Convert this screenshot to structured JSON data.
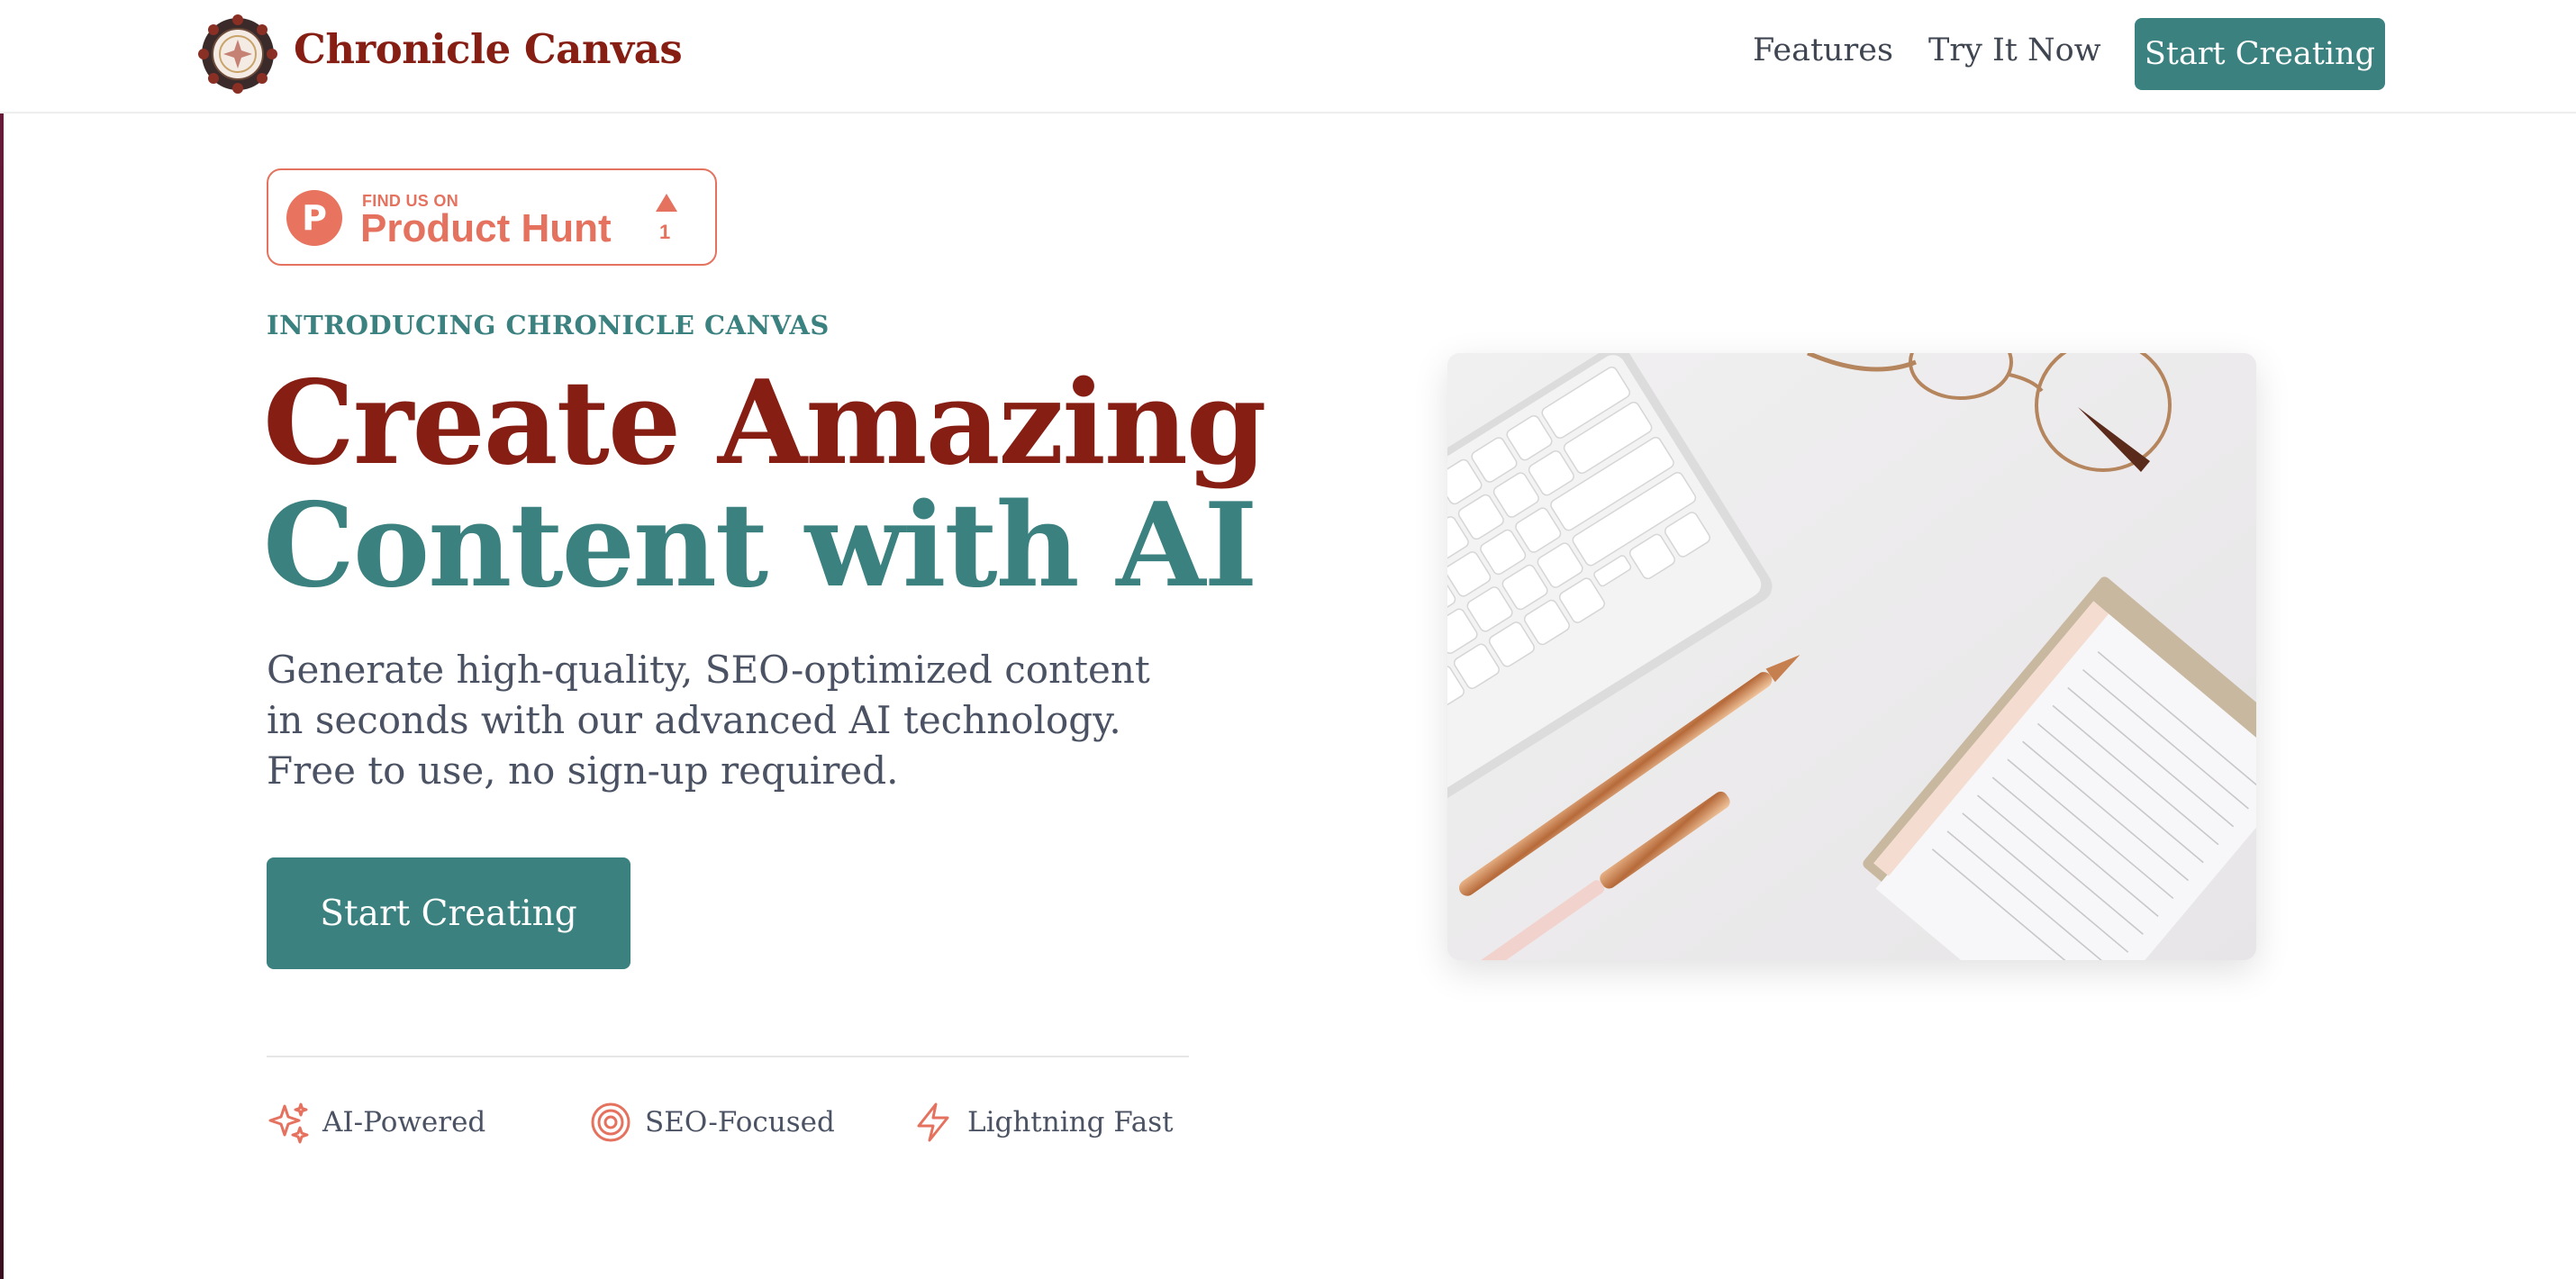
{
  "header": {
    "brand": "Chronicle Canvas",
    "logo_icon": "ornamental-seal",
    "nav": [
      {
        "label": "Features"
      },
      {
        "label": "Try It Now"
      }
    ],
    "cta_label": "Start Creating"
  },
  "product_hunt": {
    "small_text": "FIND US ON",
    "name": "Product Hunt",
    "logo_letter": "P",
    "votes": "1"
  },
  "hero": {
    "eyebrow": "INTRODUCING CHRONICLE CANVAS",
    "title_line1": "Create Amazing",
    "title_line2": "Content with AI",
    "subtitle": "Generate high-quality, SEO-optimized content in seconds with our advanced AI technology. Free to use, no sign-up required.",
    "cta_label": "Start Creating",
    "image_icon": "desk-workspace-photo"
  },
  "features": [
    {
      "label": "AI-Powered",
      "icon": "sparkles-icon"
    },
    {
      "label": "SEO-Focused",
      "icon": "target-icon"
    },
    {
      "label": "Lightning Fast",
      "icon": "lightning-icon"
    }
  ],
  "colors": {
    "brand_red": "#861e14",
    "brand_teal": "#3a8180",
    "accent_orange": "#e5725f",
    "text_gray": "#4a5263"
  }
}
